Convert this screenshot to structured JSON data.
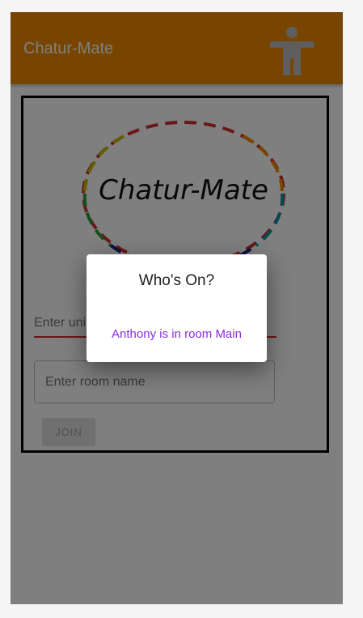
{
  "app": {
    "title": "Chatur-Mate"
  },
  "header": {
    "accessibility_icon": "accessibility-icon"
  },
  "logo": {
    "text": "Chatur-Mate",
    "ring_colors": [
      "#d32f2f",
      "#f08a00",
      "#c8b800",
      "#2e9d3a",
      "#0097a7",
      "#1a237e",
      "#4a148c"
    ]
  },
  "form": {
    "name_placeholder": "Enter unique name",
    "room_placeholder": "Enter room name",
    "join_label": "JOIN"
  },
  "dialog": {
    "title": "Who's On?",
    "items": [
      {
        "text": "Anthony is in room Main"
      }
    ]
  },
  "colors": {
    "appbar": "#f08a00",
    "link": "#8a2be2",
    "error_underline": "#d32f2f"
  }
}
